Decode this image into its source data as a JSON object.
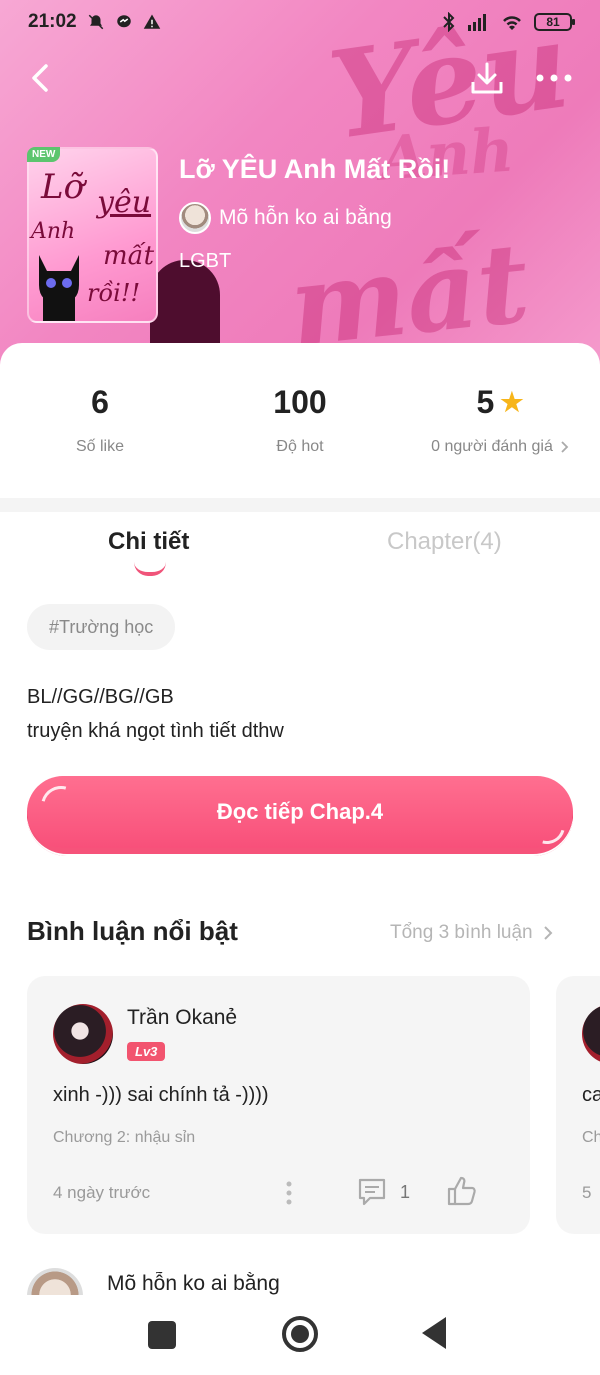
{
  "status_bar": {
    "time": "21:02",
    "battery": "81"
  },
  "header": {
    "back_icon": "chevron-left-icon",
    "download_icon": "download-icon",
    "more_icon": "more-horizontal-icon"
  },
  "story": {
    "cover_badge": "NEW",
    "title": "Lỡ YÊU Anh Mất Rồi!",
    "author": "Mõ hỗn ko ai bằng",
    "genre": "LGBT",
    "cover_text": [
      "Lỡ",
      "yêu",
      "Anh",
      "mất",
      "rồi!!"
    ]
  },
  "stats": [
    {
      "value": "6",
      "label": "Số like"
    },
    {
      "value": "100",
      "label": "Độ hot"
    },
    {
      "value": "5",
      "label": "0 người đánh giá"
    }
  ],
  "tabs": [
    {
      "label": "Chi tiết",
      "active": true
    },
    {
      "label": "Chapter(4)",
      "active": false
    }
  ],
  "tag": "#Trường học",
  "description": {
    "line1": "BL//GG//BG//GB",
    "line2": "truyện khá ngọt tình tiết dthw"
  },
  "cta": {
    "label": "Đọc tiếp Chap.4"
  },
  "comments": {
    "section_title": "Bình luận nổi bật",
    "total": "Tổng 3 bình luận",
    "items": [
      {
        "name": "Trần Okanẻ",
        "level": "Lv3",
        "text": "xinh -))) sai chính tả -))))",
        "chapter": "Chương 2: nhậu sỉn",
        "time": "4 ngày trước",
        "reply_count": "1"
      },
      {
        "peek_text": "ca",
        "peek_chapter": "Ch",
        "peek_time": "5"
      }
    ],
    "next_name": "Mõ hỗn ko ai bằng"
  },
  "colors": {
    "accent": "#f6537a",
    "star": "#f7b51a",
    "hero_pink": "#f286c2"
  }
}
